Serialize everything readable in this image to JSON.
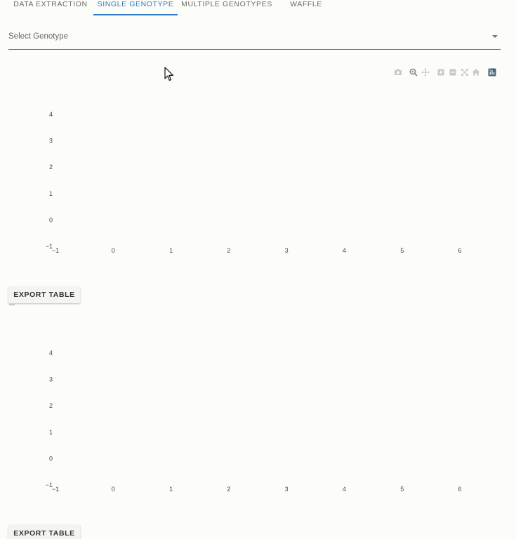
{
  "tabs": [
    {
      "label": "DATA EXTRACTION",
      "active": false
    },
    {
      "label": "SINGLE GENOTYPE",
      "active": true
    },
    {
      "label": "MULTIPLE GENOTYPES",
      "active": false
    },
    {
      "label": "WAFFLE",
      "active": false
    }
  ],
  "select": {
    "placeholder": "Select Genotype"
  },
  "modebar": {
    "buttons": [
      "camera-icon",
      "zoom-icon",
      "pan-icon",
      "zoom-in-icon",
      "zoom-out-icon",
      "autoscale-icon",
      "home-icon",
      "plotly-logo-icon"
    ]
  },
  "accent_color": "#2f7bc4",
  "plots": [
    {
      "chart_data": {
        "type": "scatter",
        "series": [],
        "x_ticks": [
          "−1",
          "0",
          "1",
          "2",
          "3",
          "4",
          "5",
          "6"
        ],
        "y_ticks": [
          "−1",
          "0",
          "1",
          "2",
          "3",
          "4"
        ],
        "xlim": [
          -1,
          6
        ],
        "ylim": [
          -1,
          4
        ],
        "grid": false
      },
      "export_label": "EXPORT TABLE"
    },
    {
      "chart_data": {
        "type": "scatter",
        "series": [],
        "x_ticks": [
          "−1",
          "0",
          "1",
          "2",
          "3",
          "4",
          "5",
          "6"
        ],
        "y_ticks": [
          "−1",
          "0",
          "1",
          "2",
          "3",
          "4"
        ],
        "xlim": [
          -1,
          6
        ],
        "ylim": [
          -1,
          4
        ],
        "grid": false
      },
      "export_label": "EXPORT TABLE"
    }
  ]
}
